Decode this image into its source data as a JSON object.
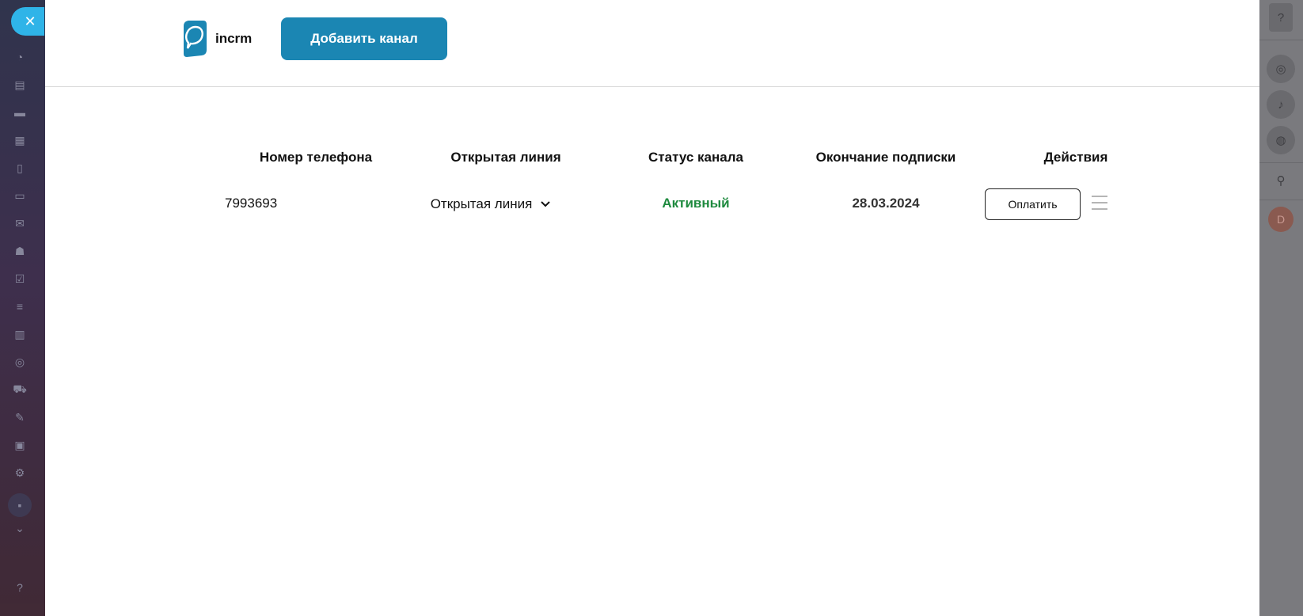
{
  "header": {
    "logo_text": "incrm",
    "add_channel_label": "Добавить канал"
  },
  "table": {
    "columns": [
      "Номер телефона",
      "Открытая линия",
      "Статус канала",
      "Окончание подписки",
      "Действия"
    ],
    "rows": [
      {
        "phone": "7993693",
        "open_line": "Открытая линия",
        "status": "Активный",
        "subscription_end": "28.03.2024",
        "action_label": "Оплатить"
      }
    ]
  },
  "right_bar": {
    "avatar_letter": "D"
  },
  "colors": {
    "accent": "#1b86b3",
    "status_active": "#1e8a3e",
    "close_button": "#2fb4e8"
  },
  "icons": {
    "close": "close-icon",
    "dropdown": "chevron-down-icon",
    "row_menu": "menu-icon"
  }
}
